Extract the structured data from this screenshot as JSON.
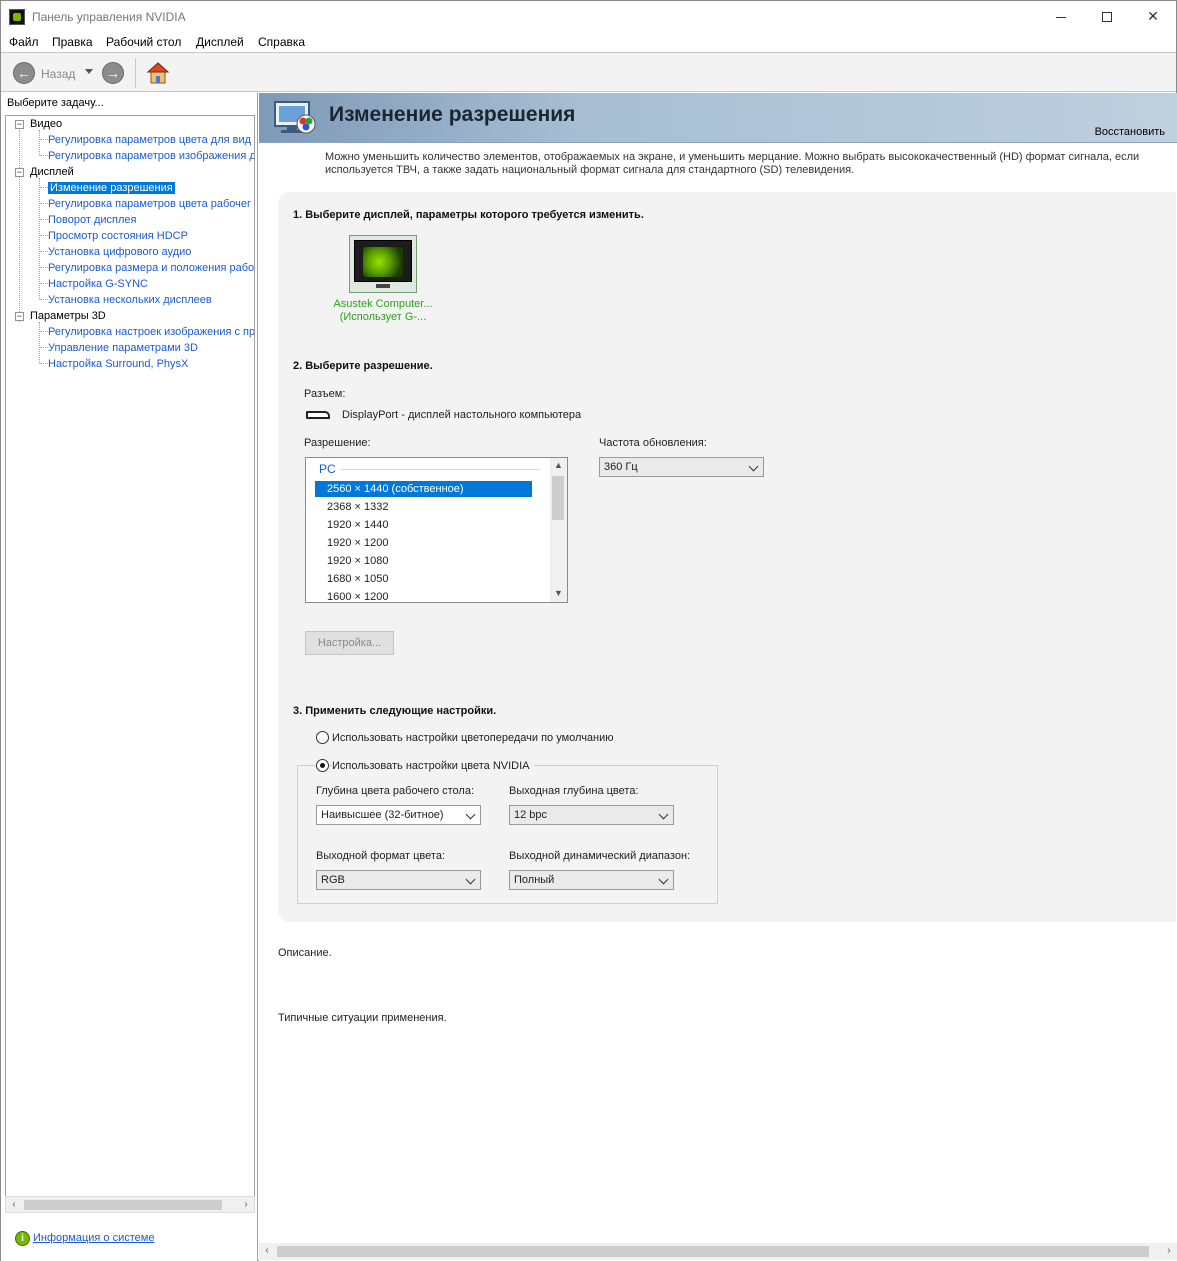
{
  "window": {
    "title": "Панель управления NVIDIA"
  },
  "menu": [
    "Файл",
    "Правка",
    "Рабочий стол",
    "Дисплей",
    "Справка"
  ],
  "toolbar": {
    "back_label": "Назад"
  },
  "left": {
    "task_label": "Выберите задачу...",
    "tree": [
      {
        "label": "Видео",
        "level": 0
      },
      {
        "label": "Регулировка параметров цвета для вид",
        "level": 1
      },
      {
        "label": "Регулировка параметров изображения д",
        "level": 1
      },
      {
        "label": "Дисплей",
        "level": 0
      },
      {
        "label": "Изменение разрешения",
        "level": 1,
        "selected": true
      },
      {
        "label": "Регулировка параметров цвета рабочег",
        "level": 1
      },
      {
        "label": "Поворот дисплея",
        "level": 1
      },
      {
        "label": "Просмотр состояния HDCP",
        "level": 1
      },
      {
        "label": "Установка цифрового аудио",
        "level": 1
      },
      {
        "label": "Регулировка размера и положения рабо",
        "level": 1
      },
      {
        "label": "Настройка G-SYNC",
        "level": 1
      },
      {
        "label": "Установка нескольких дисплеев",
        "level": 1
      },
      {
        "label": "Параметры 3D",
        "level": 0
      },
      {
        "label": "Регулировка настроек изображения с пр",
        "level": 1
      },
      {
        "label": "Управление параметрами 3D",
        "level": 1
      },
      {
        "label": "Настройка Surround, PhysX",
        "level": 1
      }
    ],
    "sysinfo_link": "Информация о системе"
  },
  "page": {
    "title": "Изменение разрешения",
    "restore": "Восстановить",
    "intro": "Можно уменьшить количество элементов, отображаемых на экране, и уменьшить мерцание. Можно выбрать высококачественный (HD) формат сигнала, если используется ТВЧ, а также задать национальный формат сигнала для стандартного (SD) телевидения.",
    "step1": "1. Выберите дисплей, параметры которого требуется изменить.",
    "monitor_name_line1": "Asustek Computer...",
    "monitor_name_line2": "(Использует G-...",
    "step2": "2. Выберите разрешение.",
    "connector_label": "Разъем:",
    "connector_value": "DisplayPort - дисплей настольного компьютера",
    "resolution_label": "Разрешение:",
    "resolution_group": "PC",
    "resolutions": [
      "2560 × 1440 (собственное)",
      "2368 × 1332",
      "1920 × 1440",
      "1920 × 1200",
      "1920 × 1080",
      "1680 × 1050",
      "1600 × 1200"
    ],
    "selected_resolution": "2560 × 1440 (собственное)",
    "refresh_label": "Частота обновления:",
    "refresh_value": "360 Гц",
    "customize_button": "Настройка...",
    "step3": "3. Применить следующие настройки.",
    "radio_default": "Использовать настройки цветопередачи по умолчанию",
    "radio_nvidia": "Использовать настройки цвета NVIDIA",
    "radio_selected": "nvidia",
    "desktop_depth_label": "Глубина цвета рабочего стола:",
    "desktop_depth_value": "Наивысшее (32-битное)",
    "output_depth_label": "Выходная глубина цвета:",
    "output_depth_value": "12 bpc",
    "output_format_label": "Выходной формат цвета:",
    "output_format_value": "RGB",
    "dynamic_range_label": "Выходной динамический диапазон:",
    "dynamic_range_value": "Полный",
    "description_label": "Описание.",
    "usage_label": "Типичные ситуации применения."
  },
  "colors": {
    "accent": "#0078d7",
    "nvidia_green": "#76b900",
    "link": "#1a5ad8"
  }
}
